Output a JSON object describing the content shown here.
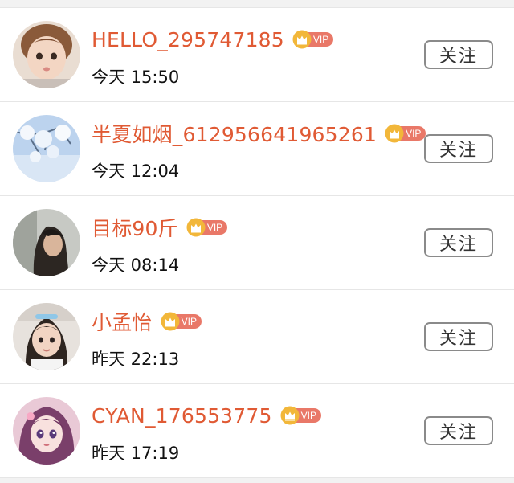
{
  "follow_label": "关注",
  "vip_label": "VIP",
  "colors": {
    "username": "#e05a34",
    "vip_tag": "#e97868",
    "crown": "#f2b73a"
  },
  "users": [
    {
      "name": "HELLO_295747185",
      "time": "今天 15:50",
      "avatar": "toddler-girl-avatar"
    },
    {
      "name": "半夏如烟_612956641965261",
      "time": "今天 12:04",
      "avatar": "blossom-tree-avatar"
    },
    {
      "name": "目标90斤",
      "time": "今天 08:14",
      "avatar": "long-hair-girl-avatar"
    },
    {
      "name": "小孟怡",
      "time": "昨天 22:13",
      "avatar": "young-girl-avatar"
    },
    {
      "name": "CYAN_176553775",
      "time": "昨天 17:19",
      "avatar": "anime-girl-avatar"
    }
  ]
}
